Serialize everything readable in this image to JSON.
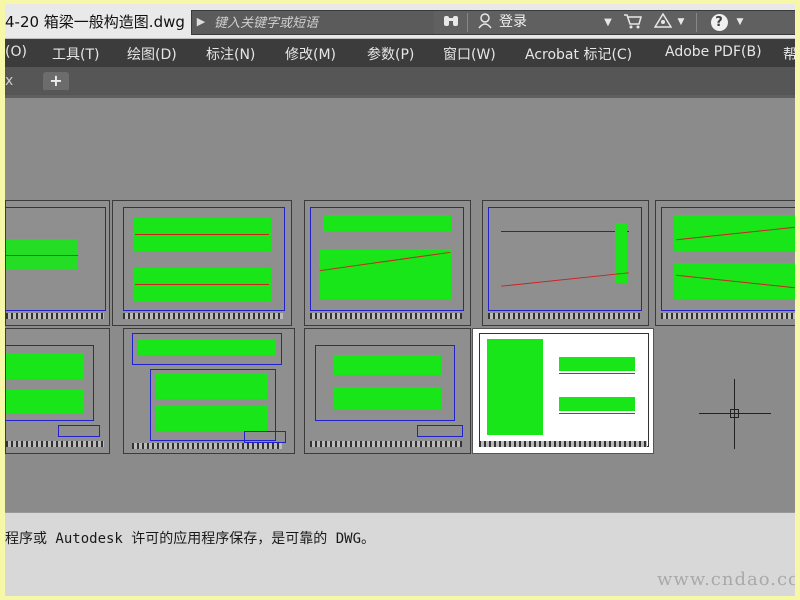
{
  "window": {
    "title": "4-20 箱梁一般构造图.dwg"
  },
  "infocenter": {
    "search_placeholder": "键入关键字或短语",
    "login_label": "登录",
    "help_icon": "?"
  },
  "menu": {
    "items": [
      {
        "label": "(O)"
      },
      {
        "label": "工具(T)"
      },
      {
        "label": "绘图(D)"
      },
      {
        "label": "标注(N)"
      },
      {
        "label": "修改(M)"
      },
      {
        "label": "参数(P)"
      },
      {
        "label": "窗口(W)"
      },
      {
        "label": "Acrobat 标记(C)"
      },
      {
        "label": "Adobe PDF(B)"
      },
      {
        "label": "帮"
      }
    ]
  },
  "tabs": {
    "close_glyph": "x",
    "add_glyph": "+"
  },
  "command": {
    "line": "程序或 Autodesk 许可的应用程序保存，是可靠的 DWG。"
  },
  "watermark": "www.cndao.com",
  "colors": {
    "drawing_green": "#19e619",
    "border_blue": "#2222cc",
    "canvas_gray": "#8b8b8b",
    "menu_dark": "#3c3c3c"
  }
}
